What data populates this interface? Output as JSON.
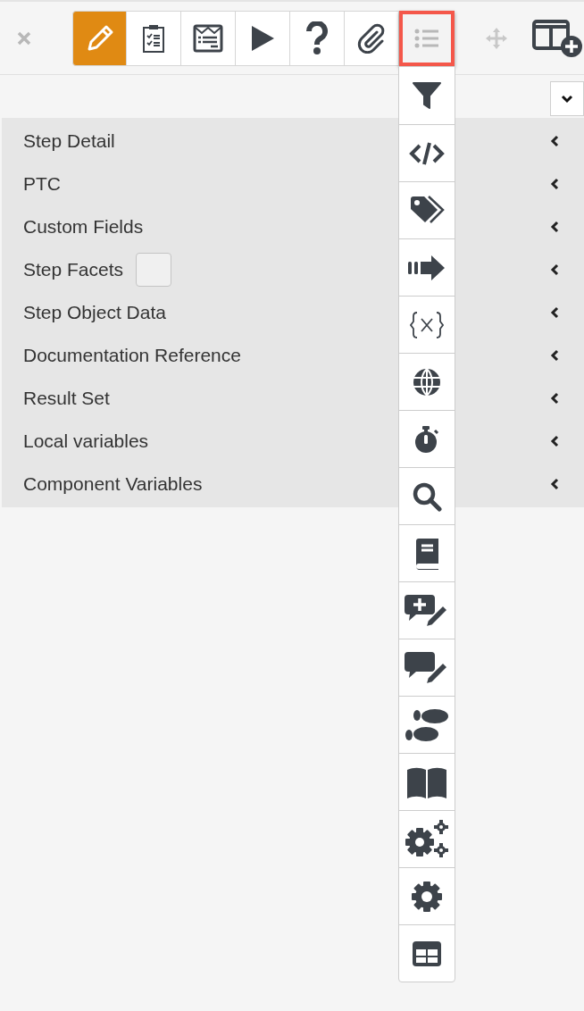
{
  "toolbar": {
    "close": {
      "kind": "close"
    },
    "buttons": [
      {
        "kind": "pencil",
        "selected": true,
        "highlighted": false
      },
      {
        "kind": "clipboard-check",
        "selected": false,
        "highlighted": false
      },
      {
        "kind": "form",
        "selected": false,
        "highlighted": false
      },
      {
        "kind": "play",
        "selected": false,
        "highlighted": false
      },
      {
        "kind": "question",
        "selected": false,
        "highlighted": false
      },
      {
        "kind": "paperclip",
        "selected": false,
        "highlighted": false
      },
      {
        "kind": "list",
        "selected": false,
        "highlighted": true
      }
    ],
    "extras": [
      {
        "kind": "move",
        "disabled": true
      },
      {
        "kind": "table-plus",
        "disabled": false
      }
    ]
  },
  "menu": {
    "items": [
      {
        "kind": "filter"
      },
      {
        "kind": "code"
      },
      {
        "kind": "tags"
      },
      {
        "kind": "arrow"
      },
      {
        "kind": "variable"
      },
      {
        "kind": "globe"
      },
      {
        "kind": "stopwatch"
      },
      {
        "kind": "search"
      },
      {
        "kind": "book"
      },
      {
        "kind": "comment-plus"
      },
      {
        "kind": "comment-pen"
      },
      {
        "kind": "footprints"
      },
      {
        "kind": "open-book"
      },
      {
        "kind": "gears"
      },
      {
        "kind": "gear"
      },
      {
        "kind": "table"
      }
    ]
  },
  "sections": [
    {
      "label": "Step Detail"
    },
    {
      "label": "PTC"
    },
    {
      "label": "Custom Fields"
    },
    {
      "label": "Step Facets",
      "checkbox": {
        "checked": false
      }
    },
    {
      "label": "Step Object Data"
    },
    {
      "label": "Documentation Reference"
    },
    {
      "label": "Result Set"
    },
    {
      "label": "Local variables"
    },
    {
      "label": "Component Variables"
    }
  ]
}
